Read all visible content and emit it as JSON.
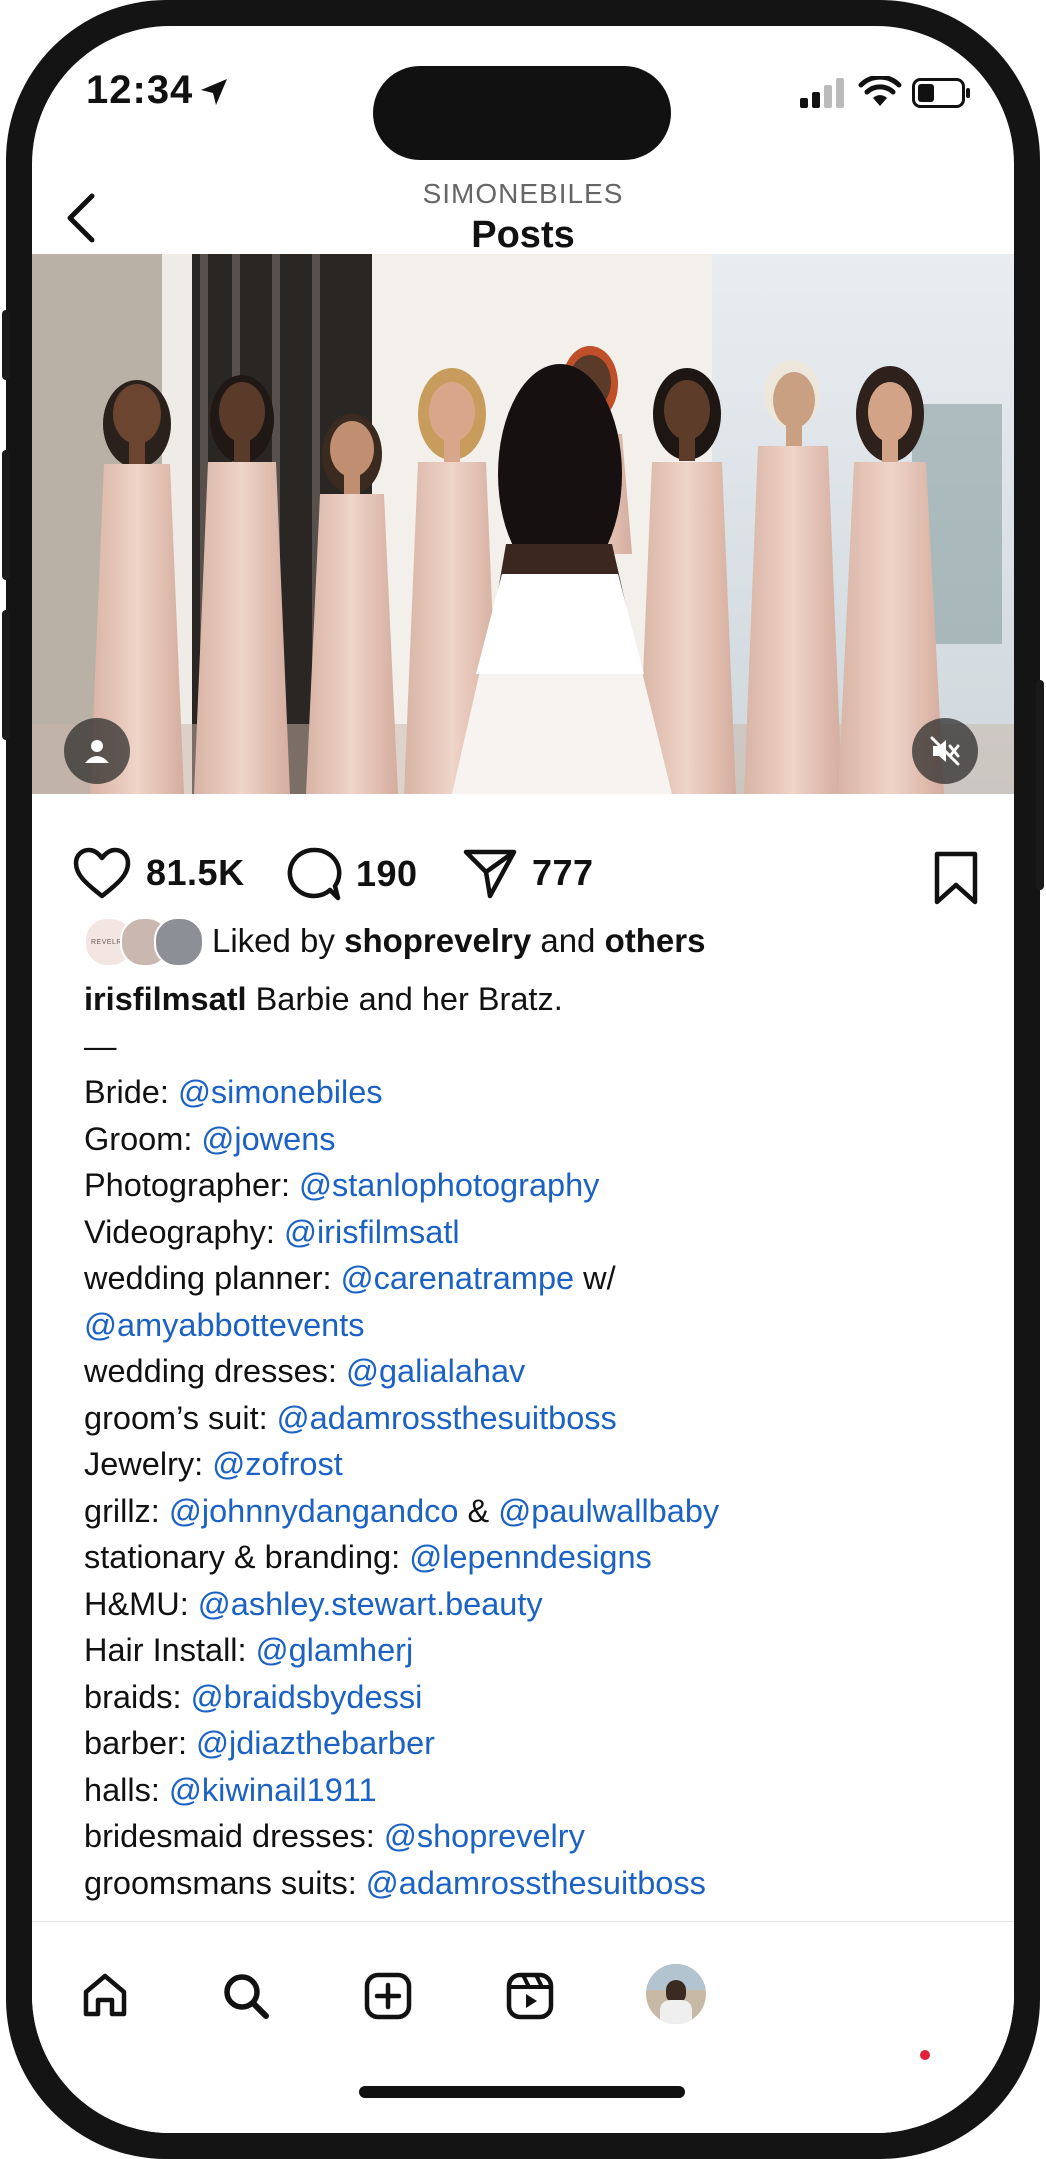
{
  "status_bar": {
    "time": "12:34"
  },
  "nav": {
    "account": "SIMONEBILES",
    "title": "Posts"
  },
  "media": {
    "profile_icon": "person-icon",
    "mute_icon": "speaker-muted-icon"
  },
  "actions": {
    "likes": "81.5K",
    "comments": "190",
    "shares": "777"
  },
  "liked_by": {
    "prefix": "Liked by ",
    "user": "shoprevelry",
    "mid": " and ",
    "others": "others",
    "avatar1_text": "REVELRY"
  },
  "caption": {
    "author": "irisfilmsatl",
    "text": " Barbie and her Bratz.",
    "dash": "—",
    "lines": [
      {
        "label": "Bride: ",
        "handles": [
          "@simonebiles"
        ]
      },
      {
        "label": "Groom: ",
        "handles": [
          "@jowens"
        ]
      },
      {
        "label": "Photographer: ",
        "handles": [
          "@stanlophotography"
        ]
      },
      {
        "label": "Videography: ",
        "handles": [
          "@irisfilmsatl"
        ]
      },
      {
        "label": "wedding planner: ",
        "handles": [
          "@carenatrampe"
        ],
        "suffix": " w/"
      },
      {
        "label": "",
        "handles": [
          "@amyabbottevents"
        ]
      },
      {
        "label": "wedding dresses: ",
        "handles": [
          "@galialahav"
        ]
      },
      {
        "label": "groom’s suit: ",
        "handles": [
          "@adamrossthesuitboss"
        ]
      },
      {
        "label": "Jewelry: ",
        "handles": [
          "@zofrost"
        ]
      },
      {
        "label": "grillz: ",
        "handles": [
          "@johnnydangandco",
          "@paulwallbaby"
        ],
        "joiner": " & "
      },
      {
        "label": "stationary & branding: ",
        "handles": [
          "@lepenndesigns"
        ]
      },
      {
        "label": "H&MU: ",
        "handles": [
          "@ashley.stewart.beauty"
        ]
      },
      {
        "label": "Hair Install: ",
        "handles": [
          "@glamherj"
        ]
      },
      {
        "label": "braids: ",
        "handles": [
          "@braidsbydessi"
        ]
      },
      {
        "label": "barber: ",
        "handles": [
          "@jdiazthebarber"
        ]
      },
      {
        "label": "halls: ",
        "handles": [
          "@kiwinail1911"
        ]
      },
      {
        "label": "bridesmaid dresses: ",
        "handles": [
          "@shoprevelry"
        ]
      },
      {
        "label": "groomsmans suits: ",
        "handles": [
          "@adamrossthesuitboss"
        ]
      }
    ]
  },
  "tabbar": {
    "items": [
      "home-icon",
      "search-icon",
      "new-post-icon",
      "reels-icon",
      "profile-avatar"
    ]
  },
  "colors": {
    "link": "#1b62c4",
    "dress": "#e6c6b8",
    "notification": "#e0213a"
  }
}
